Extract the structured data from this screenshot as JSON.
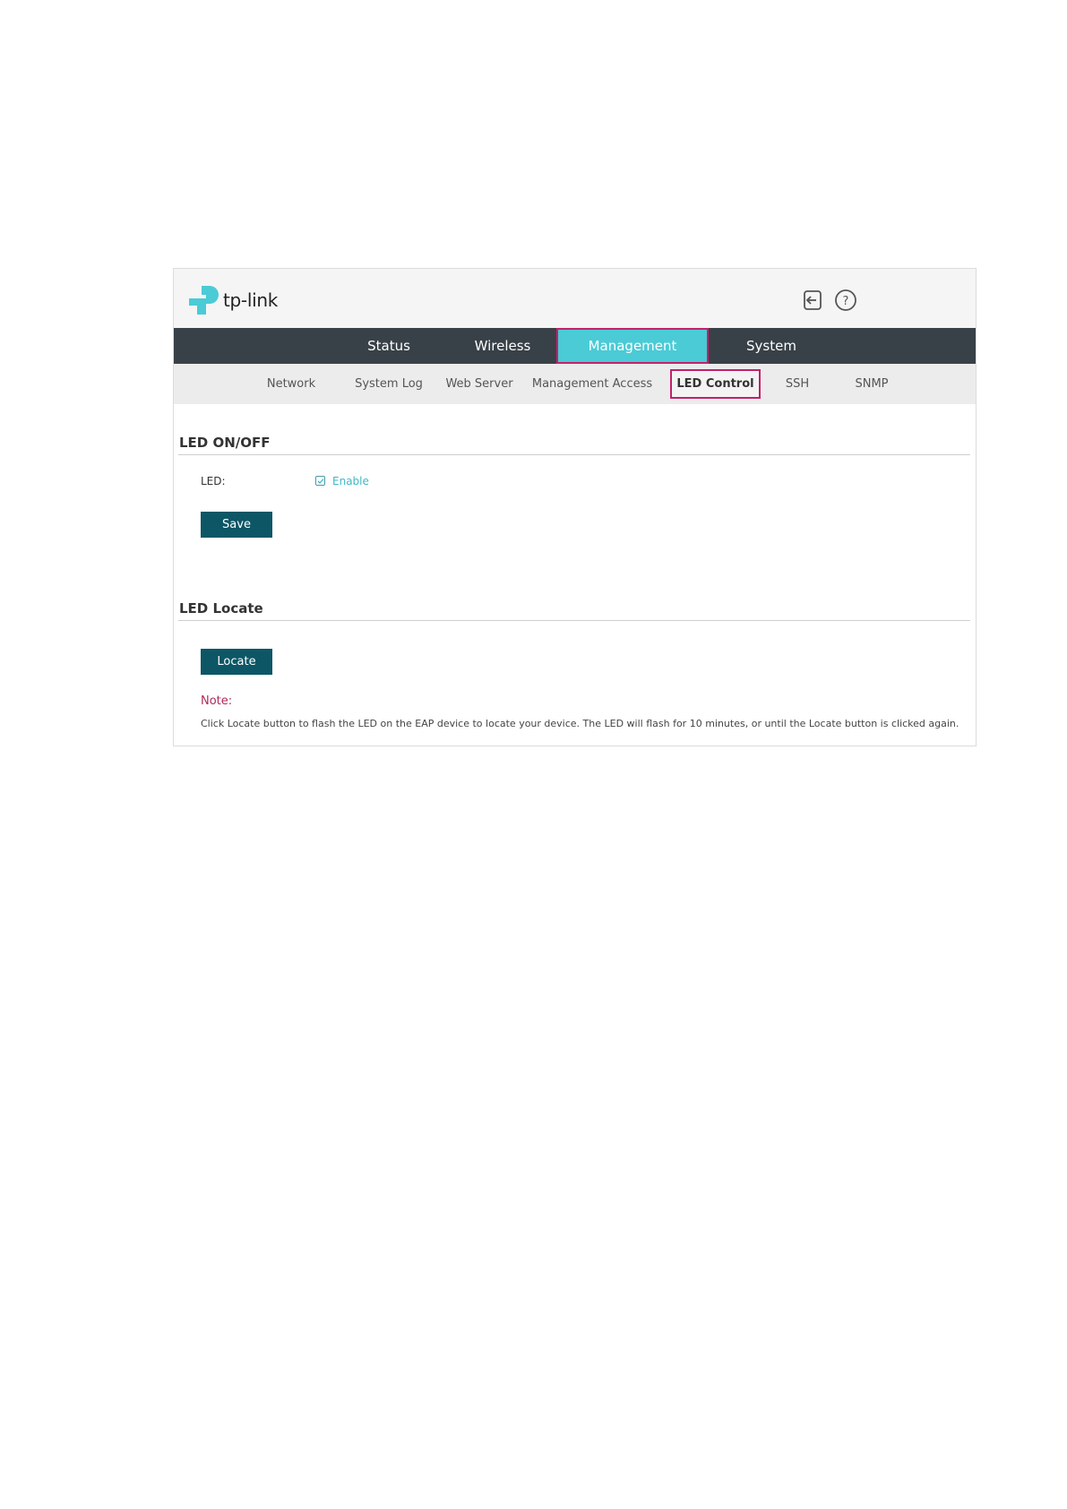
{
  "header": {
    "logo_text": "tp-link",
    "icons": {
      "logout": "logout-icon",
      "help": "help-icon"
    }
  },
  "main_nav": {
    "tabs": [
      {
        "label": "Status"
      },
      {
        "label": "Wireless"
      },
      {
        "label": "Management",
        "active": true
      },
      {
        "label": "System"
      }
    ]
  },
  "sub_nav": {
    "tabs": [
      {
        "label": "Network"
      },
      {
        "label": "System Log"
      },
      {
        "label": "Web Server"
      },
      {
        "label": "Management Access"
      },
      {
        "label": "LED Control",
        "active": true
      },
      {
        "label": "SSH"
      },
      {
        "label": "SNMP"
      }
    ]
  },
  "led_onoff": {
    "title": "LED ON/OFF",
    "field_label": "LED:",
    "checkbox_label": "Enable",
    "checked": true,
    "save_label": "Save"
  },
  "led_locate": {
    "title": "LED Locate",
    "locate_label": "Locate",
    "note_label": "Note:",
    "note_text": "Click Locate button to flash the LED on the EAP device to locate your device. The LED will flash for 10 minutes, or until the Locate button is clicked again."
  },
  "colors": {
    "brand": "#4acbd6",
    "nav_bg": "#394148",
    "button": "#0d5666",
    "highlight": "#c4206a",
    "note": "#b02a5c"
  }
}
